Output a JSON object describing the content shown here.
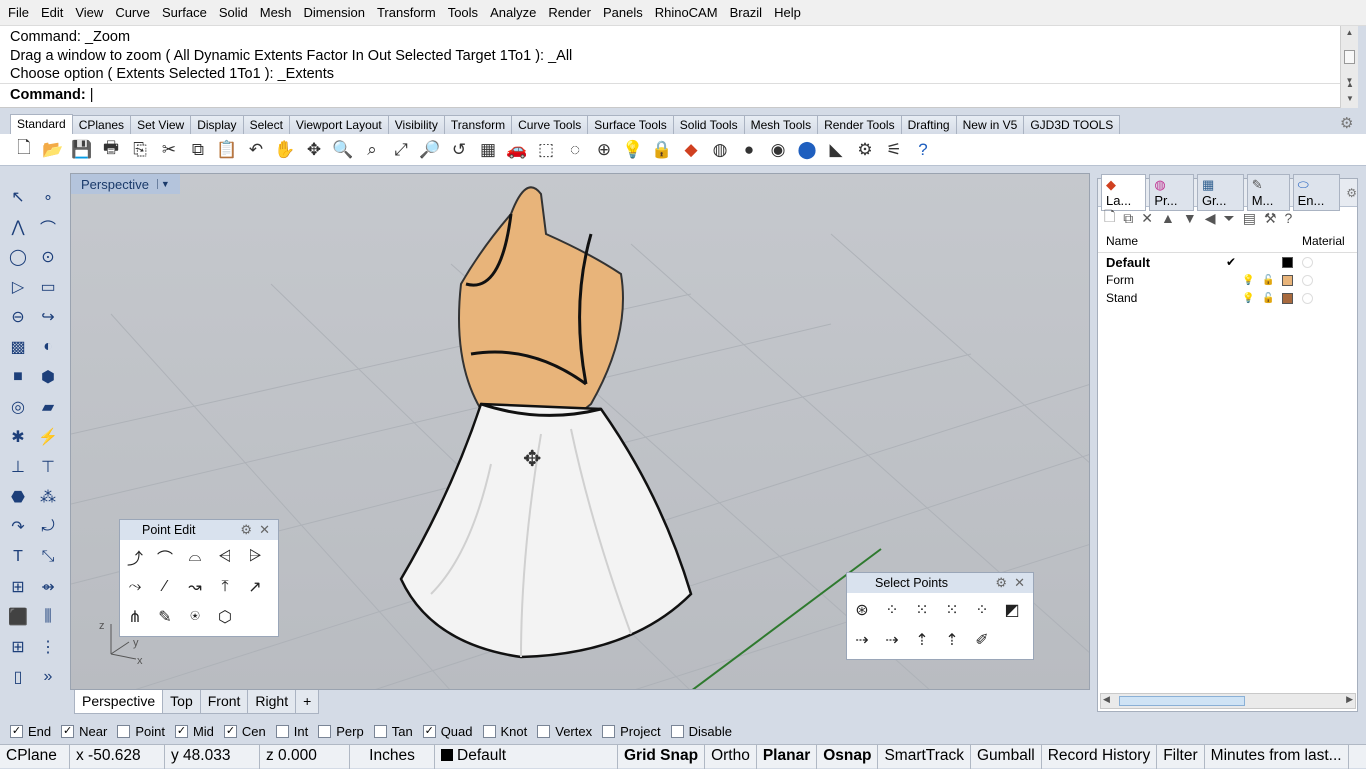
{
  "menu": [
    "File",
    "Edit",
    "View",
    "Curve",
    "Surface",
    "Solid",
    "Mesh",
    "Dimension",
    "Transform",
    "Tools",
    "Analyze",
    "Render",
    "Panels",
    "RhinoCAM",
    "Brazil",
    "Help"
  ],
  "command_history": [
    "Command: _Zoom",
    "Drag a window to zoom ( All  Dynamic  Extents  Factor  In  Out  Selected  Target  1To1 ): _All",
    "Choose option ( Extents  Selected  1To1 ): _Extents"
  ],
  "command_prompt": "Command:",
  "toolbar_tabs": [
    "Standard",
    "CPlanes",
    "Set View",
    "Display",
    "Select",
    "Viewport Layout",
    "Visibility",
    "Transform",
    "Curve Tools",
    "Surface Tools",
    "Solid Tools",
    "Mesh Tools",
    "Render Tools",
    "Drafting",
    "New in V5",
    "GJD3D TOOLS"
  ],
  "active_toolbar_tab": "Standard",
  "standard_icons": [
    "new-file-icon",
    "open-folder-icon",
    "save-icon",
    "print-icon",
    "import-icon",
    "cut-icon",
    "copy-icon",
    "paste-icon",
    "undo-icon",
    "pan-icon",
    "rotate-view-icon",
    "zoom-icon",
    "zoom-window-icon",
    "zoom-extents-icon",
    "zoom-selected-icon",
    "undo-view-icon",
    "viewport-layout-icon",
    "car-icon",
    "select-icon",
    "hide-icon",
    "show-icon",
    "light-icon",
    "lock-icon",
    "layer-icon",
    "color-wheel-icon",
    "shaded-sphere-icon",
    "rendered-sphere-icon",
    "blue-sphere-icon",
    "triangle-icon",
    "gear-tool-icon",
    "options-icon",
    "help-icon"
  ],
  "viewport": {
    "name": "Perspective",
    "axis_x": "x",
    "axis_y": "y",
    "axis_z": "z"
  },
  "viewport_tabs": [
    "Perspective",
    "Top",
    "Front",
    "Right",
    "+"
  ],
  "active_viewport_tab": "Perspective",
  "point_edit_panel": {
    "title": "Point Edit"
  },
  "select_points_panel": {
    "title": "Select Points"
  },
  "osnaps": [
    {
      "label": "End",
      "checked": true
    },
    {
      "label": "Near",
      "checked": true
    },
    {
      "label": "Point",
      "checked": false
    },
    {
      "label": "Mid",
      "checked": true
    },
    {
      "label": "Cen",
      "checked": true
    },
    {
      "label": "Int",
      "checked": false
    },
    {
      "label": "Perp",
      "checked": false
    },
    {
      "label": "Tan",
      "checked": false
    },
    {
      "label": "Quad",
      "checked": true
    },
    {
      "label": "Knot",
      "checked": false
    },
    {
      "label": "Vertex",
      "checked": false
    },
    {
      "label": "Project",
      "checked": false
    },
    {
      "label": "Disable",
      "checked": false
    }
  ],
  "status_bar": {
    "cplane": "CPlane",
    "x": "x -50.628",
    "y": "y 48.033",
    "z": "z 0.000",
    "units": "Inches",
    "layer": "Default",
    "toggles": [
      {
        "label": "Grid Snap",
        "bold": true
      },
      {
        "label": "Ortho",
        "bold": false
      },
      {
        "label": "Planar",
        "bold": true
      },
      {
        "label": "Osnap",
        "bold": true
      },
      {
        "label": "SmartTrack",
        "bold": false
      },
      {
        "label": "Gumball",
        "bold": false
      },
      {
        "label": "Record History",
        "bold": false
      },
      {
        "label": "Filter",
        "bold": false
      },
      {
        "label": "Minutes from last...",
        "bold": false
      }
    ]
  },
  "layers_panel": {
    "tabs": [
      "La...",
      "Pr...",
      "Gr...",
      "M...",
      "En..."
    ],
    "col_name": "Name",
    "col_material": "Material",
    "layers": [
      {
        "name": "Default",
        "current": "✔",
        "color": "#000000",
        "bold": true
      },
      {
        "name": "Form",
        "current": "",
        "color": "#e8b47a",
        "bold": false
      },
      {
        "name": "Stand",
        "current": "",
        "color": "#a86a3e",
        "bold": false
      }
    ]
  },
  "colors": {
    "dress": "#f3f3f3",
    "form": "#e8b47a",
    "viewport_bg": "#bfc2c7",
    "grid_x": "#8a3a3a",
    "grid_y": "#2f7a2f"
  }
}
